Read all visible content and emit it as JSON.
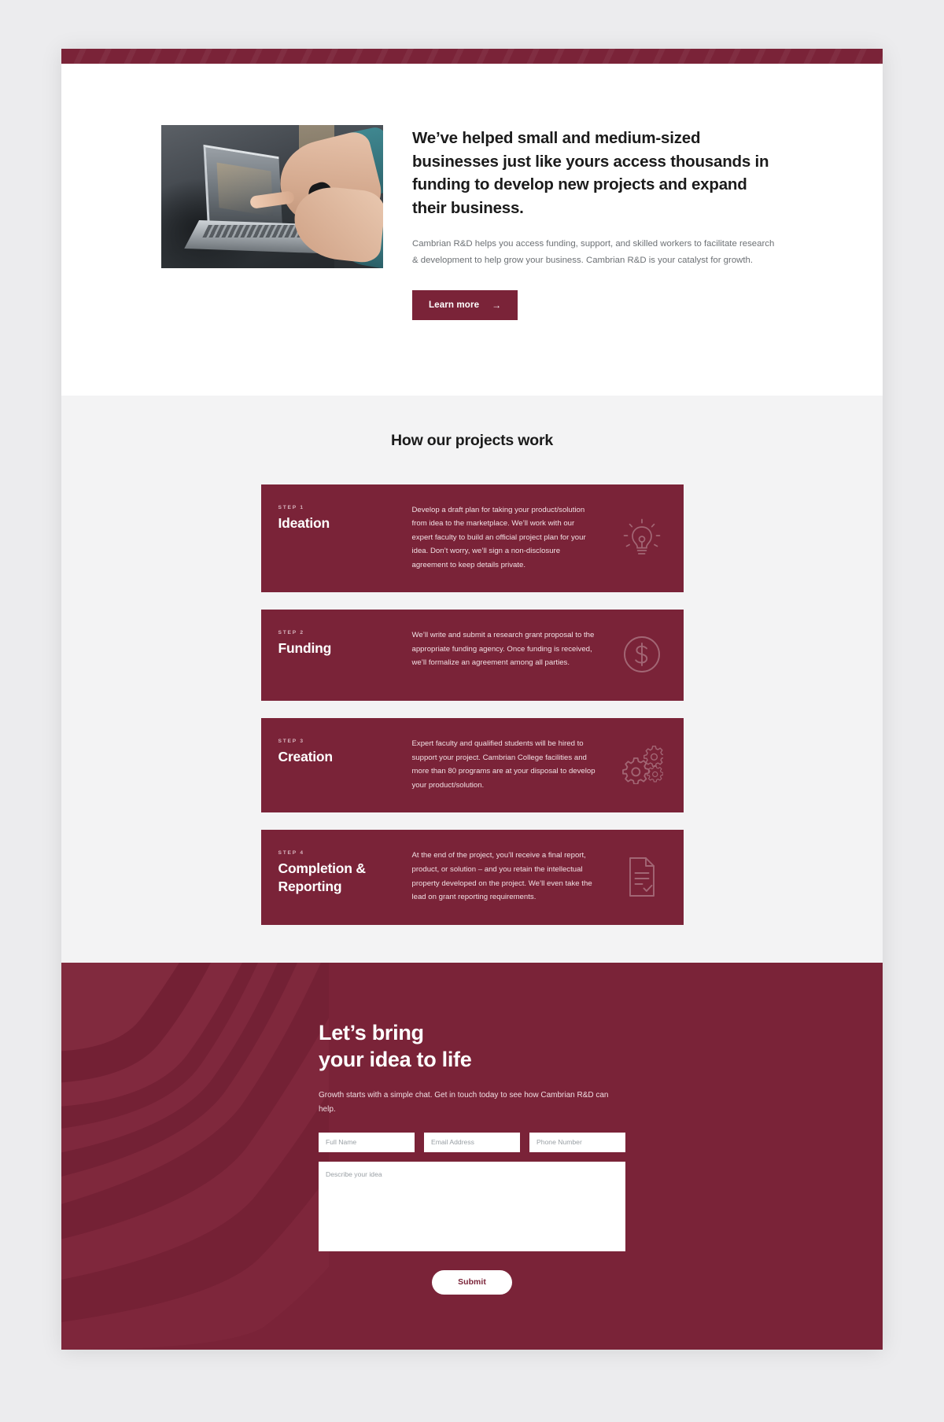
{
  "brand": {
    "maroon": "#7a2338",
    "maroon_dark": "#6d1f32",
    "page_bg": "#ececee",
    "section_bg": "#f3f3f4",
    "text_dark": "#1b1b1b",
    "text_muted": "#6d7175"
  },
  "hero": {
    "photo_alt": "person pointing at a laptop screen while another types",
    "heading": "We’ve helped small and medium-sized businesses just like yours access thousands in funding to develop new projects and expand their business.",
    "paragraph": "Cambrian R&D helps you access funding, support, and skilled workers to facilitate research & development to help grow your business. Cambrian R&D is your catalyst for growth.",
    "cta_label": "Learn more",
    "cta_arrow": "→"
  },
  "steps_section": {
    "title": "How our projects work",
    "cards": [
      {
        "kicker": "STEP 1",
        "name": "Ideation",
        "body": "Develop a draft plan for taking your product/solution from idea to the marketplace. We’ll work with our expert faculty to build an official project plan for your idea. Don’t worry, we’ll sign a non-disclosure agreement to keep details private.",
        "icon": "lightbulb-icon"
      },
      {
        "kicker": "STEP 2",
        "name": "Funding",
        "body": "We’ll write and submit a research grant proposal to the appropriate funding agency. Once funding is received, we’ll formalize an agreement among all parties.",
        "icon": "dollar-circle-icon"
      },
      {
        "kicker": "STEP 3",
        "name": "Creation",
        "body": "Expert faculty and qualified students will be hired to support your project. Cambrian College facilities and more than 80 programs are at your disposal to develop your product/solution.",
        "icon": "gears-icon"
      },
      {
        "kicker": "STEP 4",
        "name": "Completion & Reporting",
        "body": "At the end of the project, you’ll receive a final report, product, or solution – and you retain the intellectual property developed on the project. We’ll even take the lead on grant reporting requirements.",
        "icon": "document-check-icon"
      }
    ]
  },
  "cta": {
    "heading_line1": "Let’s bring",
    "heading_line2": "your idea to life",
    "paragraph": "Growth starts with a simple chat. Get in touch today to see how Cambrian R&D can help.",
    "fields": {
      "full_name": {
        "placeholder": "Full Name",
        "value": ""
      },
      "email": {
        "placeholder": "Email Address",
        "value": ""
      },
      "phone": {
        "placeholder": "Phone Number",
        "value": ""
      },
      "message": {
        "placeholder": "Describe your idea",
        "value": ""
      }
    },
    "submit_label": "Submit"
  }
}
